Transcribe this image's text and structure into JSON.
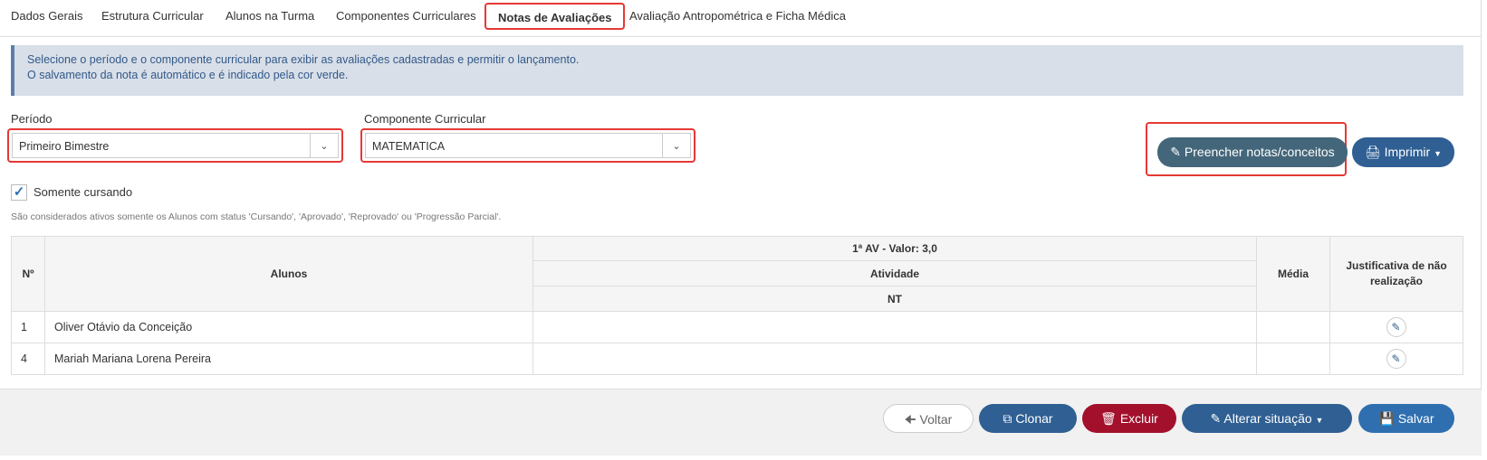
{
  "tabs": [
    {
      "label": "Dados Gerais"
    },
    {
      "label": "Estrutura Curricular"
    },
    {
      "label": "Alunos na Turma"
    },
    {
      "label": "Componentes Curriculares"
    },
    {
      "label": "Notas de Avaliações",
      "active": true
    },
    {
      "label": "Avaliação Antropométrica e Ficha Médica"
    }
  ],
  "alert": {
    "line1": "Selecione o período e o componente curricular para exibir as avaliações cadastradas e permitir o lançamento.",
    "line2": "O salvamento da nota é automático e é indicado pela cor verde."
  },
  "filters": {
    "periodo_label": "Período",
    "periodo_value": "Primeiro Bimestre",
    "componente_label": "Componente Curricular",
    "componente_value": "MATEMATICA"
  },
  "actions": {
    "fill_label": "Preencher notas/conceitos",
    "print_label": "Imprimir"
  },
  "checkbox": {
    "label": "Somente cursando",
    "checked": true
  },
  "note": "São considerados ativos somente os Alunos com status 'Cursando', 'Aprovado', 'Reprovado' ou 'Progressão Parcial'.",
  "table": {
    "col_no": "Nº",
    "col_alunos": "Alunos",
    "av_header": "1ª AV - Valor: 3,0",
    "activity": "Atividade",
    "nt": "NT",
    "col_media": "Média",
    "col_just": "Justificativa de não realização",
    "rows": [
      {
        "no": "1",
        "aluno": "Oliver Otávio da Conceição"
      },
      {
        "no": "4",
        "aluno": "Mariah Mariana Lorena Pereira"
      }
    ]
  },
  "footer": {
    "voltar": "Voltar",
    "clonar": "Clonar",
    "excluir": "Excluir",
    "alterar": "Alterar situação",
    "salvar": "Salvar"
  },
  "colors": {
    "primary": "#2f5f93",
    "fill_button": "#44667a",
    "danger": "#a3102c",
    "highlight": "#e53935",
    "alert_bg": "#d9dfe8"
  }
}
